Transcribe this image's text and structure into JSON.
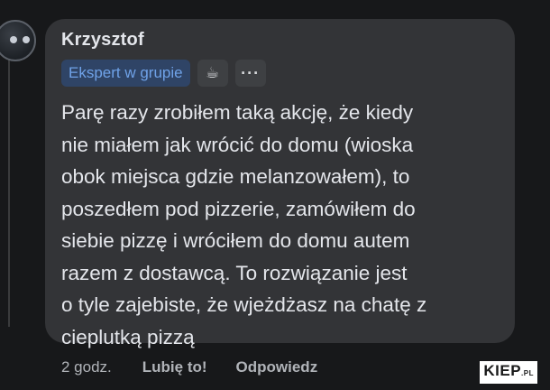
{
  "comment": {
    "author": "Krzysztof",
    "badge": "Ekspert w grupie",
    "badge_icon": "coffee-cup-icon",
    "more_icon": "ellipsis-icon",
    "more_label": "···",
    "badge_icon_glyph": "☕",
    "text": "Parę razy zrobiłem taką akcję, że kiedy\nnie miałem jak wrócić do domu (wioska\nobok miejsca gdzie melanzowałem), to\nposzedłem pod pizzerie, zamówiłem do\nsiebie pizzę i wróciłem do domu autem\nrazem z dostawcą. To rozwiązanie jest\no tyle zajebiste, że wjeżdżasz na chatę z\ncieplutką pizzą"
  },
  "actions": {
    "time": "2 godz.",
    "like": "Lubię to!",
    "reply": "Odpowiedz"
  },
  "watermark": {
    "main": "KIEP",
    "suffix": ".PL"
  },
  "colors": {
    "background": "#17181a",
    "bubble": "#333437",
    "badge_bg": "#2f4466",
    "badge_text": "#6fa2e8"
  }
}
